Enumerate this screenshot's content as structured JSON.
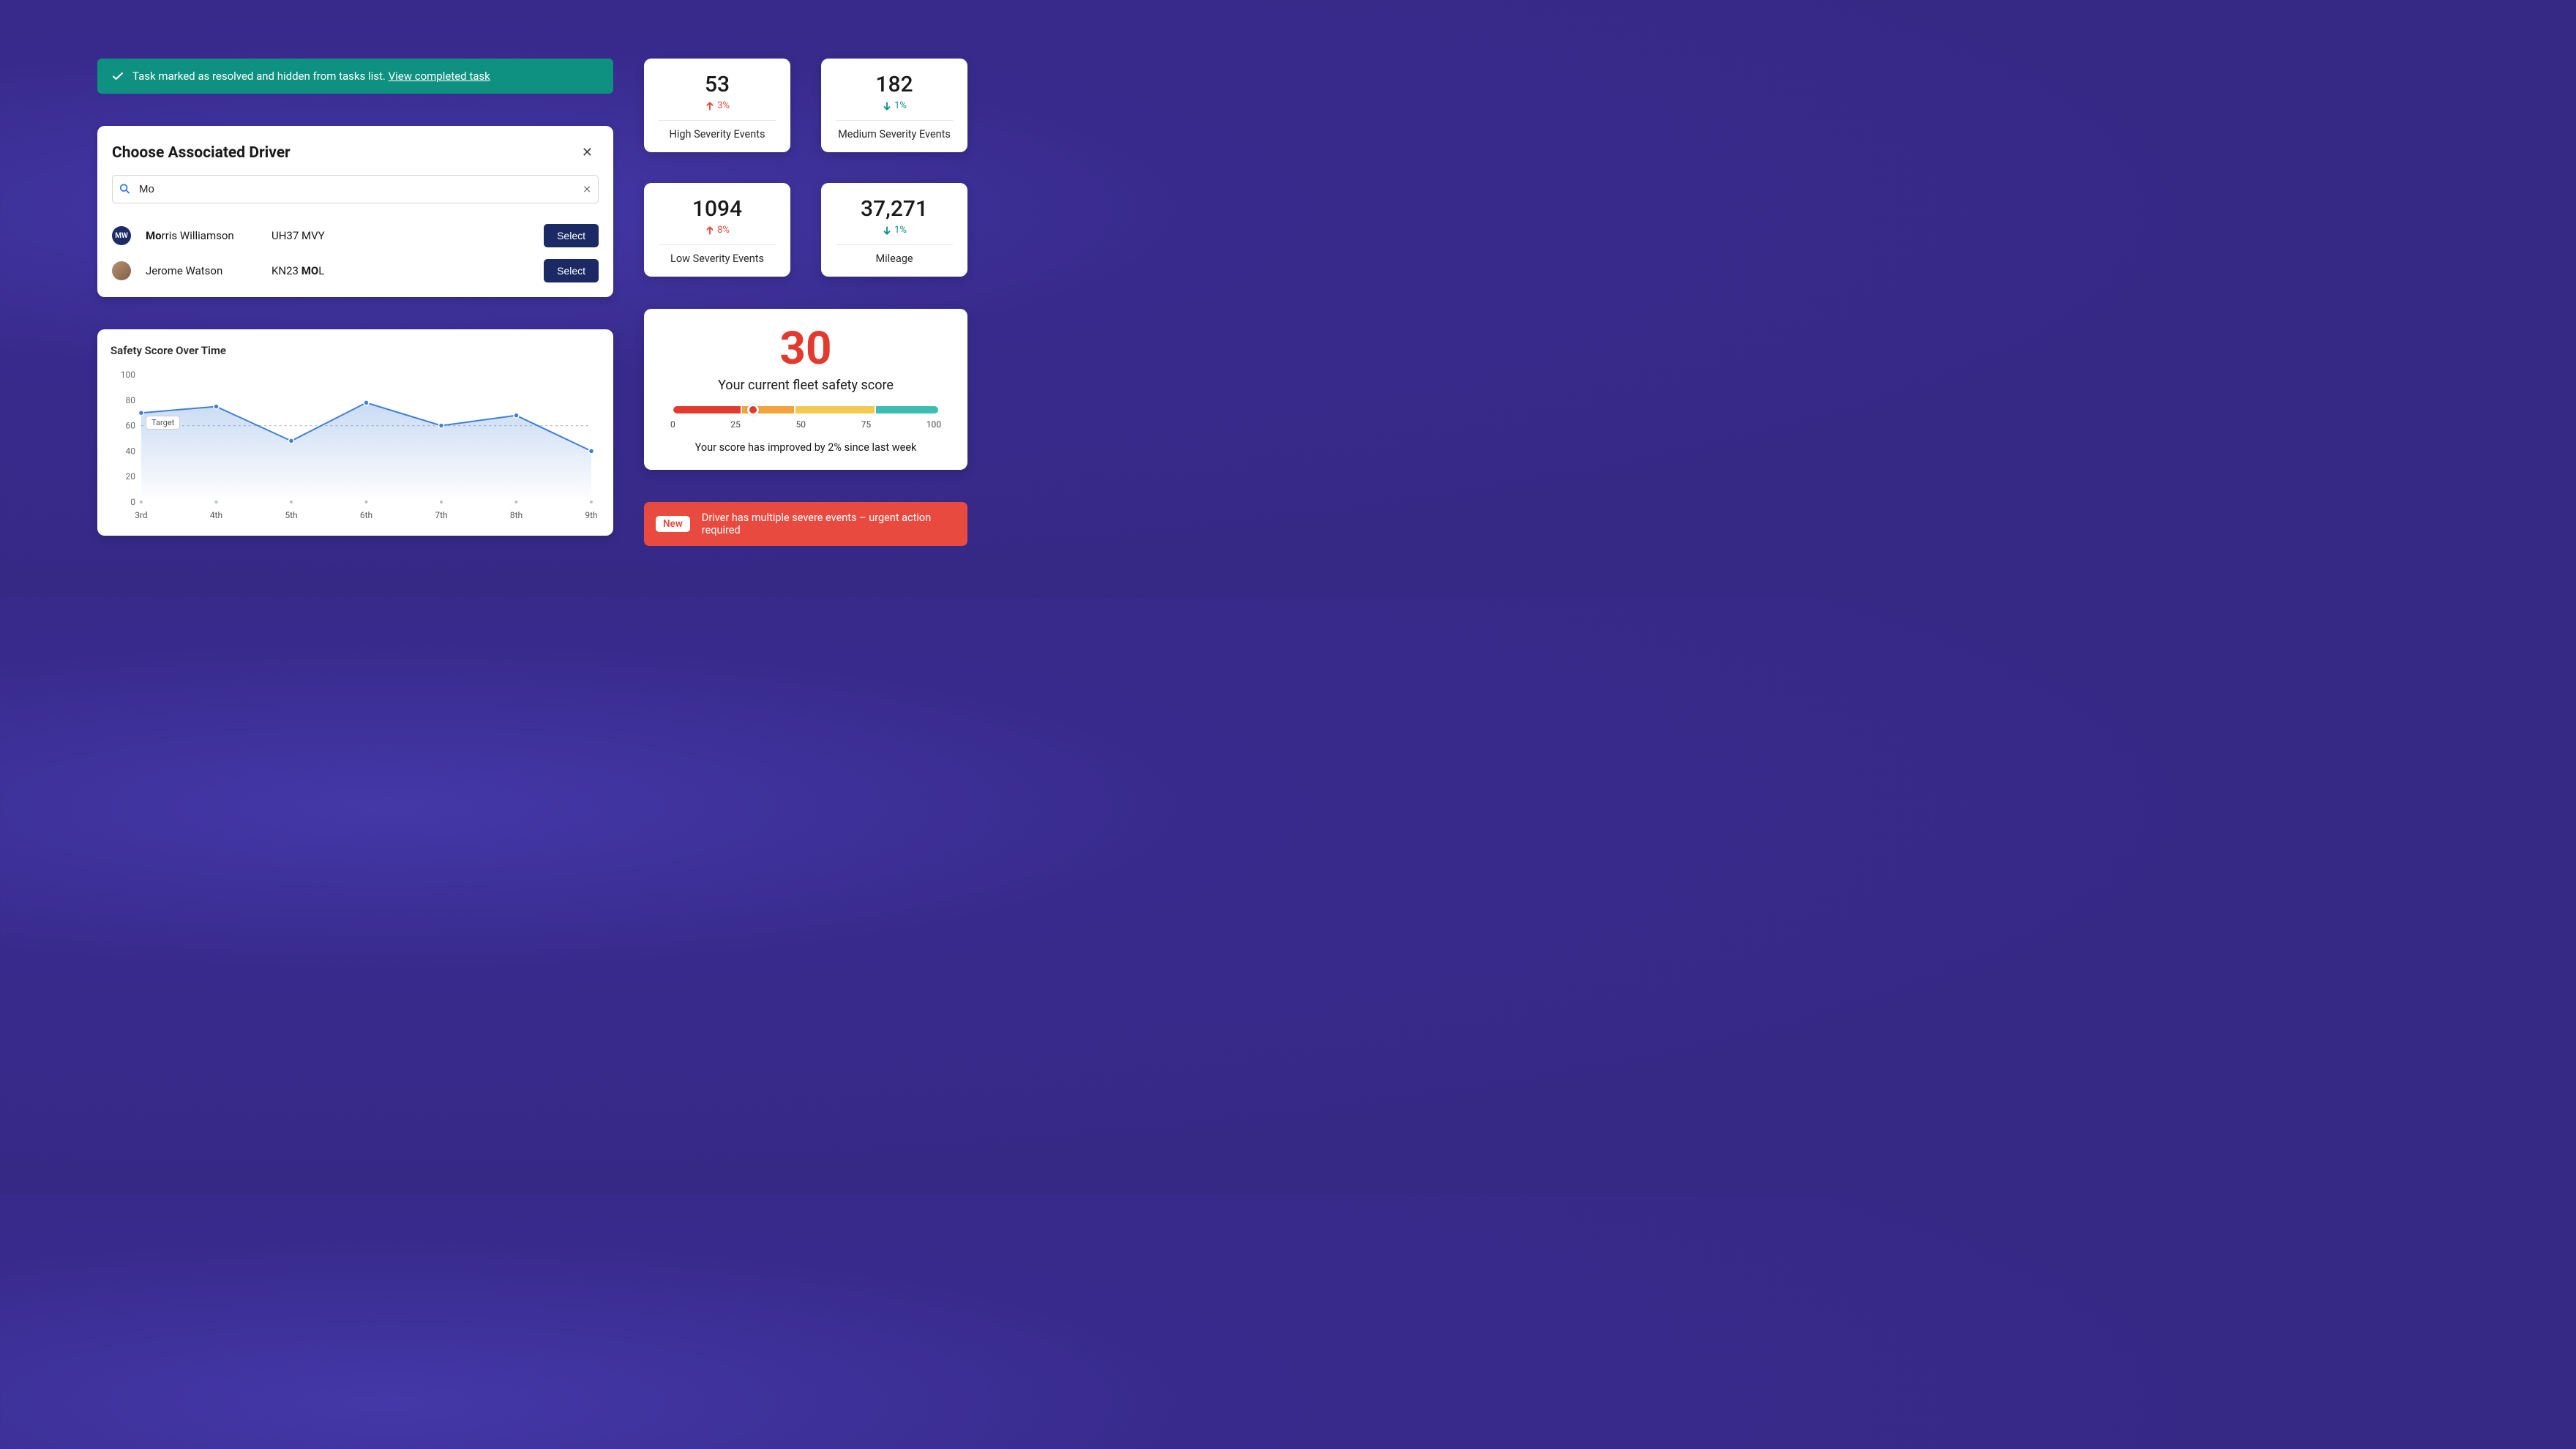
{
  "banner": {
    "text": "Task marked as resolved and hidden from tasks list. ",
    "link": "View completed task"
  },
  "driver_picker": {
    "title": "Choose Associated Driver",
    "search_value": "Mo",
    "select_label": "Select",
    "rows": [
      {
        "initials": "MW",
        "name_prefix": "Mo",
        "name_rest": "rris Williamson",
        "plate_prefix": "UH37 MVY",
        "plate_bold": "",
        "plate_suffix": ""
      },
      {
        "initials": "",
        "name_prefix": "",
        "name_rest": "Jerome Watson",
        "plate_prefix": "KN23 ",
        "plate_bold": "MO",
        "plate_suffix": "L"
      }
    ]
  },
  "chart_data": {
    "type": "line",
    "title": "Safety Score Over Time",
    "xlabel": "",
    "ylabel": "",
    "target_label": "Target",
    "target_value": 60,
    "ylim": [
      0,
      100
    ],
    "y_ticks": [
      0,
      20,
      40,
      60,
      80,
      100
    ],
    "categories": [
      "3rd",
      "4th",
      "5th",
      "6th",
      "7th",
      "8th",
      "9th"
    ],
    "values": [
      70,
      75,
      48,
      78,
      60,
      68,
      40
    ]
  },
  "tiles": [
    {
      "value": "53",
      "direction": "up",
      "delta": "3%",
      "label": "High Severity Events"
    },
    {
      "value": "182",
      "direction": "down",
      "delta": "1%",
      "label": "Medium Severity Events"
    },
    {
      "value": "1094",
      "direction": "up",
      "delta": "8%",
      "label": "Low Severity Events"
    },
    {
      "value": "37,271",
      "direction": "down",
      "delta": "1%",
      "label": "Mileage"
    }
  ],
  "score": {
    "value": "30",
    "subtitle": "Your current fleet safety score",
    "ticks": [
      "0",
      "25",
      "50",
      "75",
      "100"
    ],
    "thumb_percent": 30,
    "note": "Your score has improved by 2% since last week"
  },
  "alert": {
    "badge": "New",
    "text": "Driver has multiple severe events – urgent action required"
  }
}
